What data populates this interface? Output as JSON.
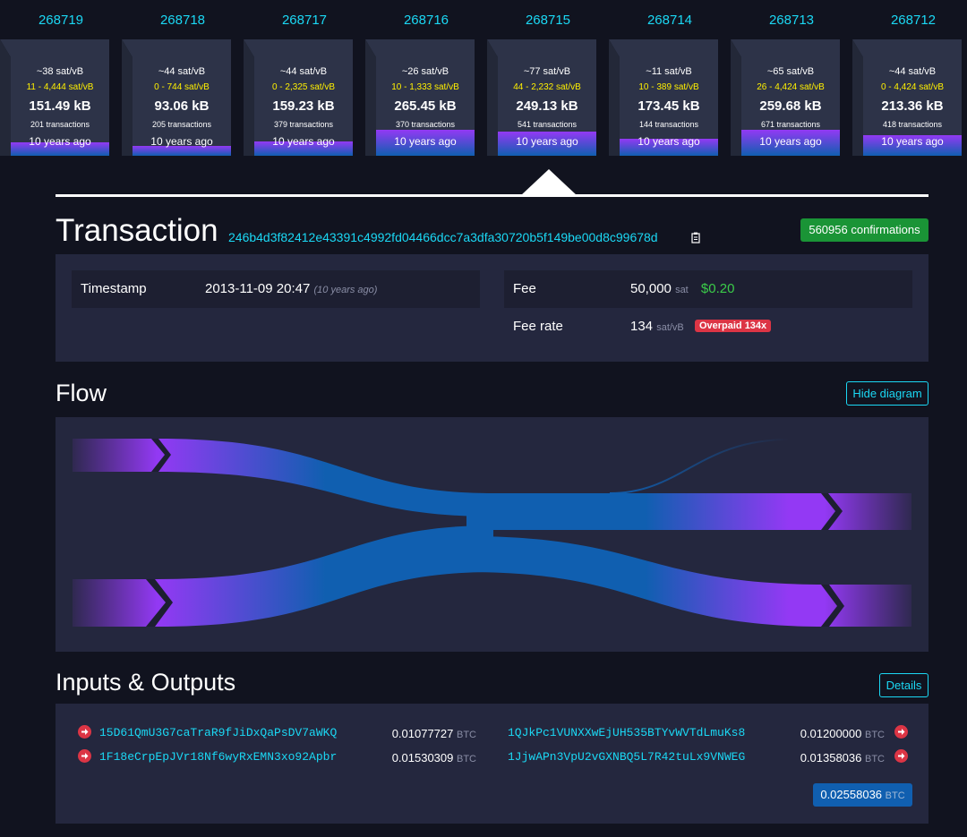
{
  "blocks": [
    {
      "height": "268719",
      "fee": "~38 sat/vB",
      "range": "11 - 4,444 sat/vB",
      "size": "151.49 kB",
      "txs": "201 transactions",
      "ago": "10 years ago",
      "fill": 0.14
    },
    {
      "height": "268718",
      "fee": "~44 sat/vB",
      "range": "0 - 744 sat/vB",
      "size": "93.06 kB",
      "txs": "205 transactions",
      "ago": "10 years ago",
      "fill": 0.09
    },
    {
      "height": "268717",
      "fee": "~44 sat/vB",
      "range": "0 - 2,325 sat/vB",
      "size": "159.23 kB",
      "txs": "379 transactions",
      "ago": "10 years ago",
      "fill": 0.15
    },
    {
      "height": "268716",
      "fee": "~26 sat/vB",
      "range": "10 - 1,333 sat/vB",
      "size": "265.45 kB",
      "txs": "370 transactions",
      "ago": "10 years ago",
      "fill": 0.26
    },
    {
      "height": "268715",
      "fee": "~77 sat/vB",
      "range": "44 - 2,232 sat/vB",
      "size": "249.13 kB",
      "txs": "541 transactions",
      "ago": "10 years ago",
      "fill": 0.25
    },
    {
      "height": "268714",
      "fee": "~11 sat/vB",
      "range": "10 - 389 sat/vB",
      "size": "173.45 kB",
      "txs": "144 transactions",
      "ago": "10 years ago",
      "fill": 0.17
    },
    {
      "height": "268713",
      "fee": "~65 sat/vB",
      "range": "26 - 4,424 sat/vB",
      "size": "259.68 kB",
      "txs": "671 transactions",
      "ago": "10 years ago",
      "fill": 0.26
    },
    {
      "height": "268712",
      "fee": "~44 sat/vB",
      "range": "0 - 4,424 sat/vB",
      "size": "213.36 kB",
      "txs": "418 transactions",
      "ago": "10 years ago",
      "fill": 0.21
    }
  ],
  "transaction": {
    "title": "Transaction",
    "txid": "246b4d3f82412e43391c4992fd04466dcc7a3dfa30720b5f149be00d8c99678d",
    "confirmations": "560956 confirmations",
    "timestamp_label": "Timestamp",
    "timestamp_value": "2013-11-09 20:47",
    "timestamp_relative": "(10 years ago)",
    "fee_label": "Fee",
    "fee_value": "50,000",
    "fee_unit": "sat",
    "fee_fiat": "$0.20",
    "fee_rate_label": "Fee rate",
    "fee_rate_value": "134",
    "fee_rate_unit": "sat/vB",
    "overpaid_badge": "Overpaid 134x"
  },
  "flow": {
    "title": "Flow",
    "hide_button": "Hide diagram"
  },
  "io": {
    "title": "Inputs & Outputs",
    "details_button": "Details",
    "inputs": [
      {
        "address": "15D61QmU3G7caTraR9fJiDxQaPsDV7aWKQ",
        "amount": "0.01077727",
        "unit": "BTC"
      },
      {
        "address": "1F18eCrpEpJVr18Nf6wyRxEMN3xo92Apbr",
        "amount": "0.01530309",
        "unit": "BTC"
      }
    ],
    "outputs": [
      {
        "address": "1QJkPc1VUNXXwEjUH535BTYvWVTdLmuKs8",
        "amount": "0.01200000",
        "unit": "BTC"
      },
      {
        "address": "1JjwAPn3VpU2vGXNBQ5L7R42tuLx9VNWEG",
        "amount": "0.01358036",
        "unit": "BTC"
      }
    ],
    "total_amount": "0.02558036",
    "total_unit": "BTC"
  },
  "colors": {
    "accent": "#1bd8f4",
    "background": "#11131f",
    "panel": "#24273e",
    "confirm_green": "#1a9436",
    "danger": "#dc3545",
    "flow_purple": "#9339f4",
    "flow_blue": "#105fb0"
  }
}
